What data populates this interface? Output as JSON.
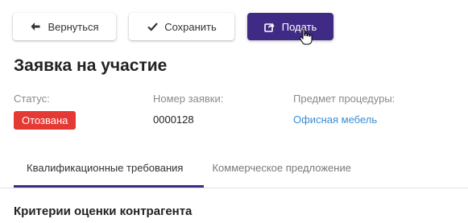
{
  "toolbar": {
    "back": {
      "label": "Вернуться",
      "icon": "arrow-left-icon"
    },
    "save": {
      "label": "Сохранить",
      "icon": "check-icon"
    },
    "submit": {
      "label": "Подать",
      "icon": "share-square-icon",
      "color": "#3f2a86"
    }
  },
  "page": {
    "title": "Заявка на участие"
  },
  "meta": {
    "status": {
      "label": "Статус:",
      "value": "Отозвана",
      "color": "#e53935"
    },
    "number": {
      "label": "Номер заявки:",
      "value": "0000128"
    },
    "subject": {
      "label": "Предмет процедуры:",
      "value": "Офисная мебель",
      "color": "#3b8dd4"
    }
  },
  "tabs": [
    {
      "label": "Квалификационные требования",
      "active": true
    },
    {
      "label": "Коммерческое предложение",
      "active": false
    }
  ],
  "section": {
    "title": "Критерии оценки контрагента"
  }
}
